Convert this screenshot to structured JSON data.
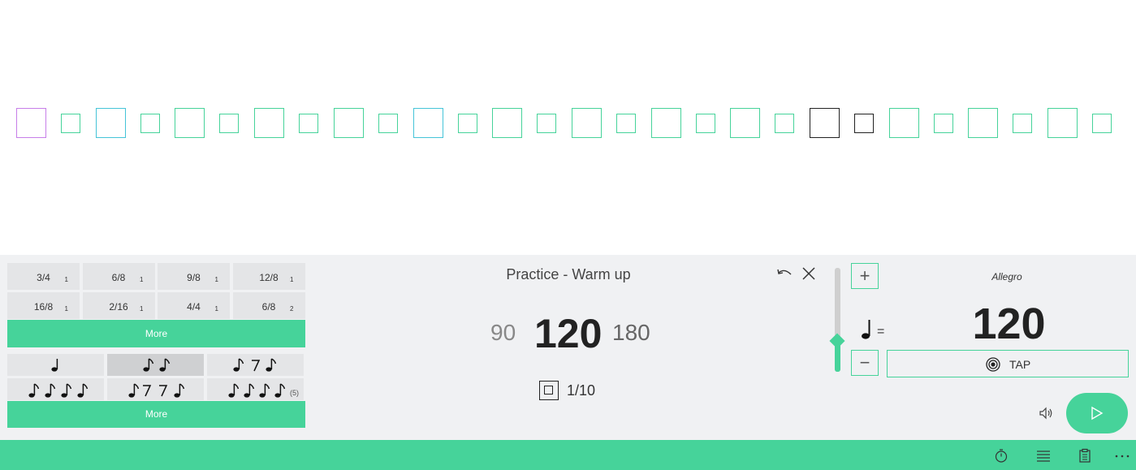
{
  "beats": {
    "big_colors": [
      "#c77ee8",
      "#45c4d8",
      "#46d39a",
      "#46d39a",
      "#46d39a",
      "#45c4d8",
      "#46d39a",
      "#46d39a",
      "#46d39a",
      "#46d39a",
      "#222222",
      "#46d39a",
      "#46d39a",
      "#46d39a"
    ],
    "small_colors": [
      "#46d39a",
      "#46d39a",
      "#46d39a",
      "#46d39a",
      "#46d39a",
      "#46d39a",
      "#46d39a",
      "#46d39a",
      "#46d39a",
      "#46d39a",
      "#222222",
      "#46d39a",
      "#46d39a",
      "#46d39a"
    ]
  },
  "time_signatures": [
    {
      "sig": "3/4",
      "sub": "1"
    },
    {
      "sig": "6/8",
      "sub": "1"
    },
    {
      "sig": "9/8",
      "sub": "1"
    },
    {
      "sig": "12/8",
      "sub": "1"
    },
    {
      "sig": "16/8",
      "sub": "1"
    },
    {
      "sig": "2/16",
      "sub": "1"
    },
    {
      "sig": "4/4",
      "sub": "1"
    },
    {
      "sig": "6/8",
      "sub": "2"
    }
  ],
  "more_time_label": "More",
  "rhythms": {
    "tuplet_label": "(5)",
    "selected_index": 1,
    "items": [
      "quarter",
      "two-eighths",
      "eighth-rest-eighth",
      "four-sixteenths",
      "sixteenth-rests",
      "quintuplet"
    ]
  },
  "more_rhythm_label": "More",
  "practice": {
    "title": "Practice - Warm up",
    "tempo_low": "90",
    "tempo_current": "120",
    "tempo_high": "180",
    "count": "1/10"
  },
  "tempo": {
    "plus_label": "+",
    "minus_label": "−",
    "equals": "=",
    "name": "Allegro",
    "bpm": "120",
    "tap_label": "TAP",
    "slider_fraction": 0.3
  },
  "icons": {
    "undo": "undo-icon",
    "close": "close-icon",
    "volume": "volume-icon",
    "play": "play-icon",
    "stopwatch": "stopwatch-icon",
    "list": "list-icon",
    "clipboard": "clipboard-icon",
    "more": "more-icon"
  },
  "colors": {
    "accent": "#46d39a",
    "panel": "#f0f1f3"
  }
}
